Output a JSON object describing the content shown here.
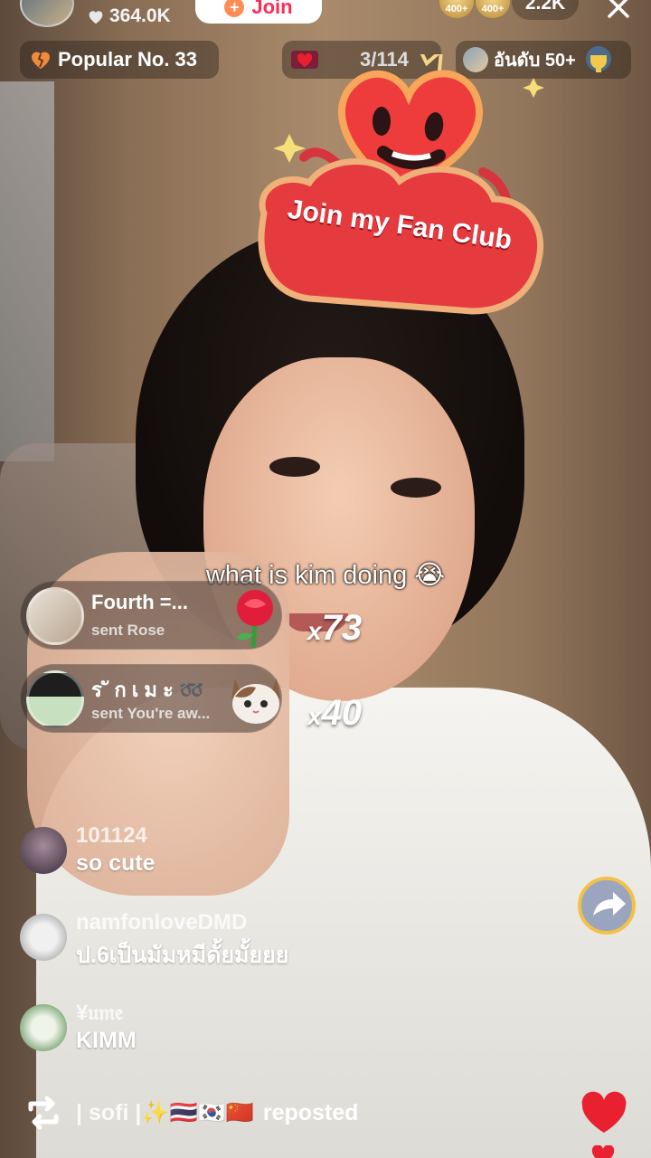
{
  "header": {
    "likes_count": "364.0K",
    "join_label": "Join",
    "coin_badges": [
      "400+",
      "400+"
    ],
    "viewers_count": "2.2K"
  },
  "rank_bar": {
    "popular_label": "Popular No. 33",
    "fan_count": "3/114",
    "rank_label": "อันดับ 50+"
  },
  "sticker": {
    "text": "Join my Fan Club"
  },
  "caption": "what is kim doing 😭",
  "gifts": [
    {
      "user": "Fourth =...",
      "text": "sent Rose",
      "combo_prefix": "x",
      "combo_count": "73",
      "icon": "rose-icon"
    },
    {
      "user": "ร ั ก เ ม ะ ➿",
      "text": "sent You're aw...",
      "combo_prefix": "x",
      "combo_count": "40",
      "icon": "cat-icon"
    }
  ],
  "comments": [
    {
      "user": "101124",
      "text": "so cute"
    },
    {
      "user": "namfonloveDMD",
      "text": "ป.6เป็นมัมหมีดั้ยมั้ยยย"
    },
    {
      "user": "¥𝔲𝔪𝔢",
      "text": "KIMM"
    }
  ],
  "repost": {
    "user": "| sofi |✨🇹🇭🇰🇷🇨🇳",
    "action": "reposted"
  },
  "colors": {
    "accent": "#fe2c55",
    "join_plus": "#fe8c55",
    "like_heart": "#e8202f"
  }
}
